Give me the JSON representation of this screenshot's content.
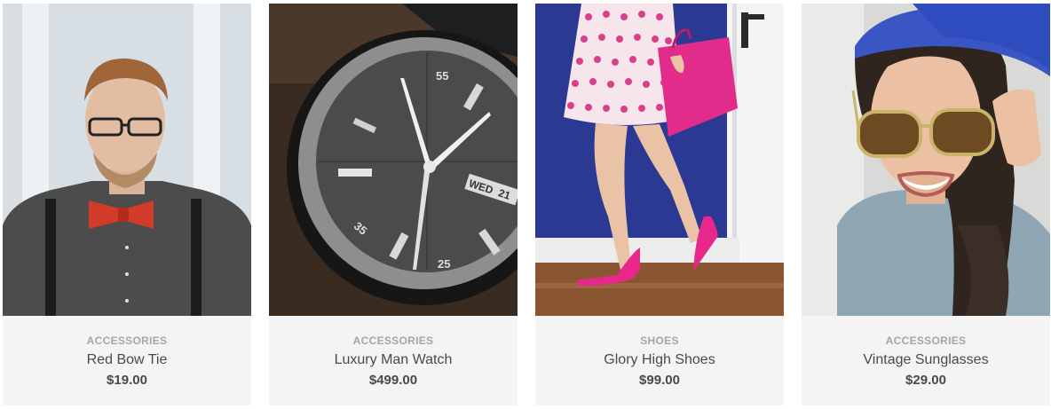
{
  "products": [
    {
      "category": "ACCESSORIES",
      "name": "Red Bow Tie",
      "price": "$19.00",
      "image": "man-with-red-bow-tie-photo"
    },
    {
      "category": "ACCESSORIES",
      "name": "Luxury Man Watch",
      "price": "$499.00",
      "image": "wristwatch-closeup-photo"
    },
    {
      "category": "SHOES",
      "name": "Glory High Shoes",
      "price": "$99.00",
      "image": "pink-high-heels-photo"
    },
    {
      "category": "ACCESSORIES",
      "name": "Vintage Sunglasses",
      "price": "$29.00",
      "image": "woman-with-sunglasses-photo"
    }
  ],
  "watch_dial": {
    "n55": "55",
    "n35": "35",
    "n25": "25",
    "day": "WED",
    "date": "21"
  }
}
